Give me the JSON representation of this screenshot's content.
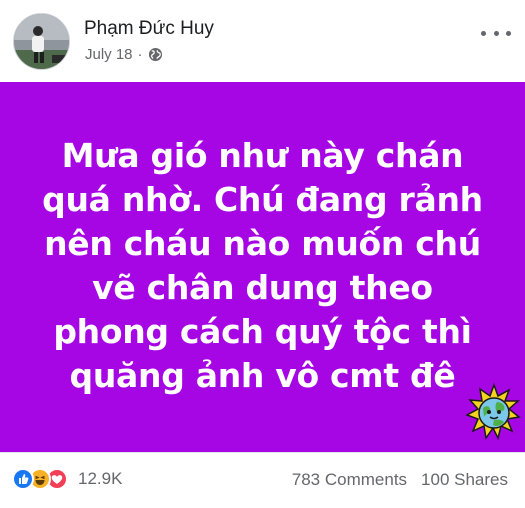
{
  "post": {
    "author": "Phạm Đức Huy",
    "date": "July 18",
    "separator": "·",
    "privacy_icon": "globe-icon",
    "more_icon": "more-options-icon",
    "background_color": "#a606e3",
    "text_color": "#ffffff",
    "text_lines": [
      "Mưa gió như này chán",
      "quá nhờ. Chú đang rảnh",
      "nên cháu nào muốn chú",
      "vẽ chân dung theo",
      "phong cách quý tộc thì",
      "quăng ảnh vô cmt đê"
    ]
  },
  "footer": {
    "reactions": [
      "like",
      "haha",
      "love"
    ],
    "reaction_count": "12.9K",
    "comments": "783 Comments",
    "shares": "100 Shares"
  }
}
